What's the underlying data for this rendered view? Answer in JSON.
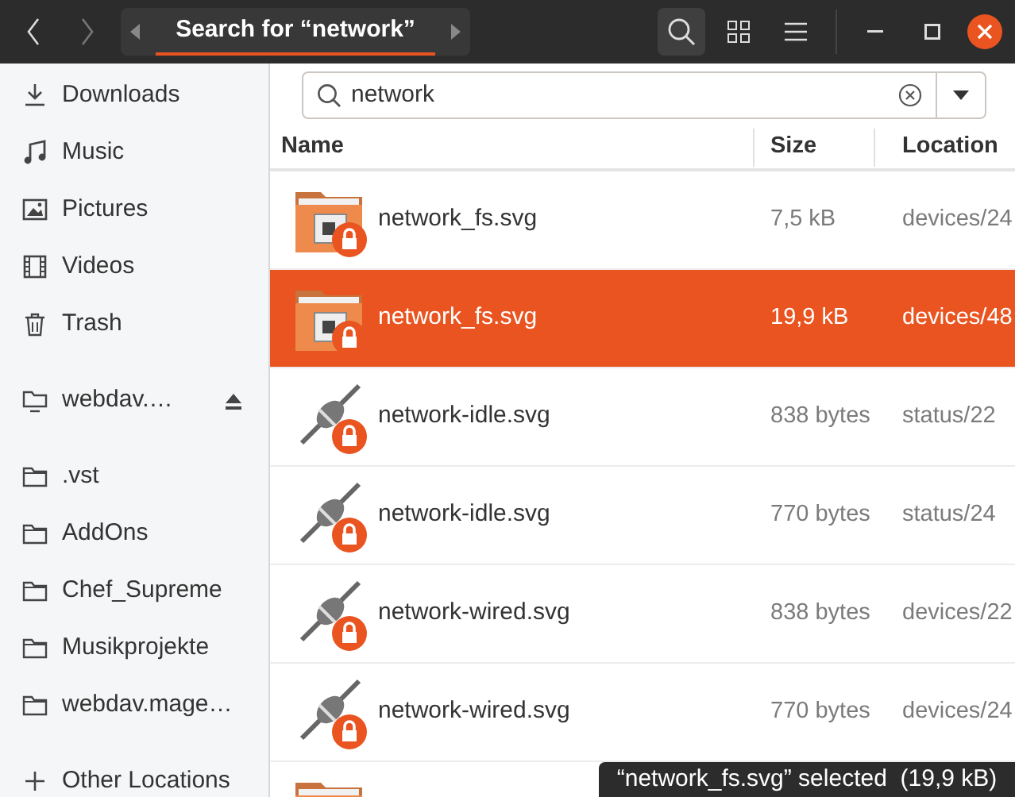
{
  "header": {
    "back_disabled": false,
    "forward_disabled": true,
    "path_title": "Search for “network”",
    "search_active": true
  },
  "sidebar": {
    "groups": [
      [
        {
          "label": "Downloads",
          "kind": "download"
        },
        {
          "label": "Music",
          "kind": "music"
        },
        {
          "label": "Pictures",
          "kind": "pictures"
        },
        {
          "label": "Videos",
          "kind": "videos"
        },
        {
          "label": "Trash",
          "kind": "trash"
        }
      ],
      [
        {
          "label": "webdav.…",
          "kind": "drive",
          "eject": true
        }
      ],
      [
        {
          "label": ".vst",
          "kind": "folder"
        },
        {
          "label": "AddOns",
          "kind": "folder"
        },
        {
          "label": "Chef_Supreme",
          "kind": "folder"
        },
        {
          "label": "Musikprojekte",
          "kind": "folder"
        },
        {
          "label": "webdav.mage…",
          "kind": "folder"
        }
      ],
      [
        {
          "label": "Other Locations",
          "kind": "plus"
        }
      ]
    ]
  },
  "search": {
    "value": "network"
  },
  "table": {
    "columns": [
      "Name",
      "Size",
      "Location"
    ],
    "rows": [
      {
        "kind": "folder",
        "name": "network_fs.svg",
        "size": "7,5 kB",
        "location": "devices/24",
        "selected": false
      },
      {
        "kind": "folder",
        "name": "network_fs.svg",
        "size": "19,9 kB",
        "location": "devices/48",
        "selected": true
      },
      {
        "kind": "plug",
        "name": "network-idle.svg",
        "size": "838 bytes",
        "location": "status/22",
        "selected": false
      },
      {
        "kind": "plug",
        "name": "network-idle.svg",
        "size": "770 bytes",
        "location": "status/24",
        "selected": false
      },
      {
        "kind": "plug",
        "name": "network-wired.svg",
        "size": "838 bytes",
        "location": "devices/22",
        "selected": false
      },
      {
        "kind": "plug",
        "name": "network-wired.svg",
        "size": "770 bytes",
        "location": "devices/24",
        "selected": false
      }
    ],
    "partial_row": {
      "kind": "folder"
    }
  },
  "status_bar": "“network_fs.svg” selected  (19,9 kB)"
}
